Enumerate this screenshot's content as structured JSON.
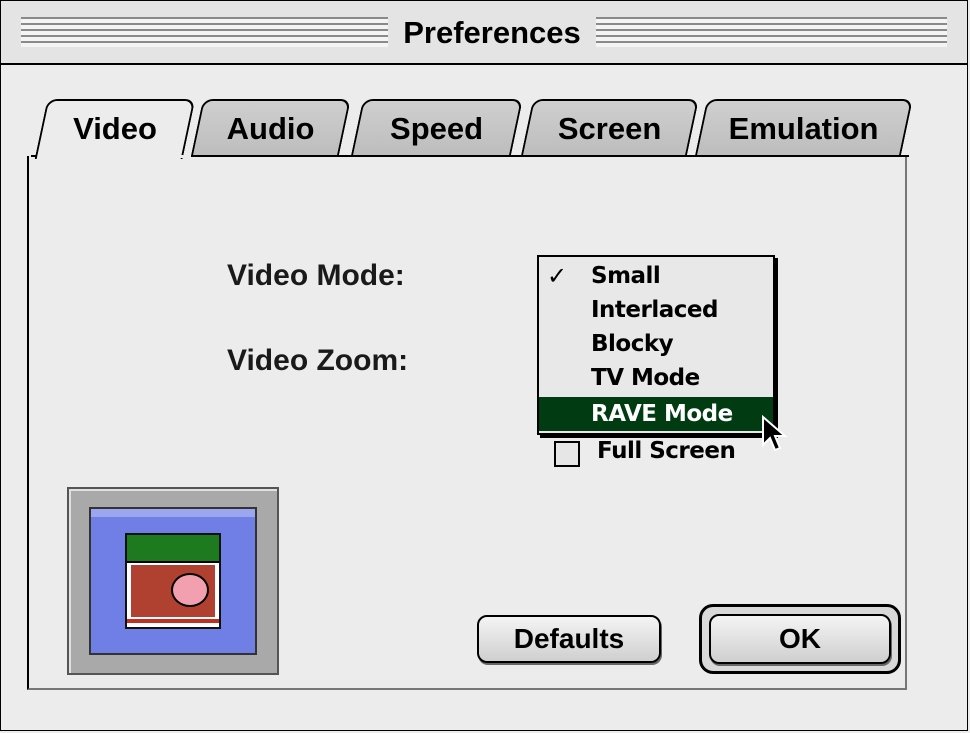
{
  "window": {
    "title": "Preferences"
  },
  "tabs": [
    {
      "label": "Video",
      "active": true
    },
    {
      "label": "Audio",
      "active": false
    },
    {
      "label": "Speed",
      "active": false
    },
    {
      "label": "Screen",
      "active": false
    },
    {
      "label": "Emulation",
      "active": false
    }
  ],
  "video": {
    "mode_label": "Video Mode:",
    "zoom_label": "Video Zoom:",
    "mode_menu": {
      "items": [
        "Small",
        "Interlaced",
        "Blocky",
        "TV Mode",
        "RAVE Mode"
      ],
      "checked_index": 0,
      "highlighted_index": 4,
      "highlight_color": "#003b12"
    },
    "fullscreen": {
      "label": "Full Screen",
      "checked": false
    }
  },
  "buttons": {
    "defaults": "Defaults",
    "ok": "OK"
  },
  "icons": {
    "check": "checkmark-icon",
    "cursor": "arrow-cursor-icon",
    "preview": "video-preview-icon"
  }
}
